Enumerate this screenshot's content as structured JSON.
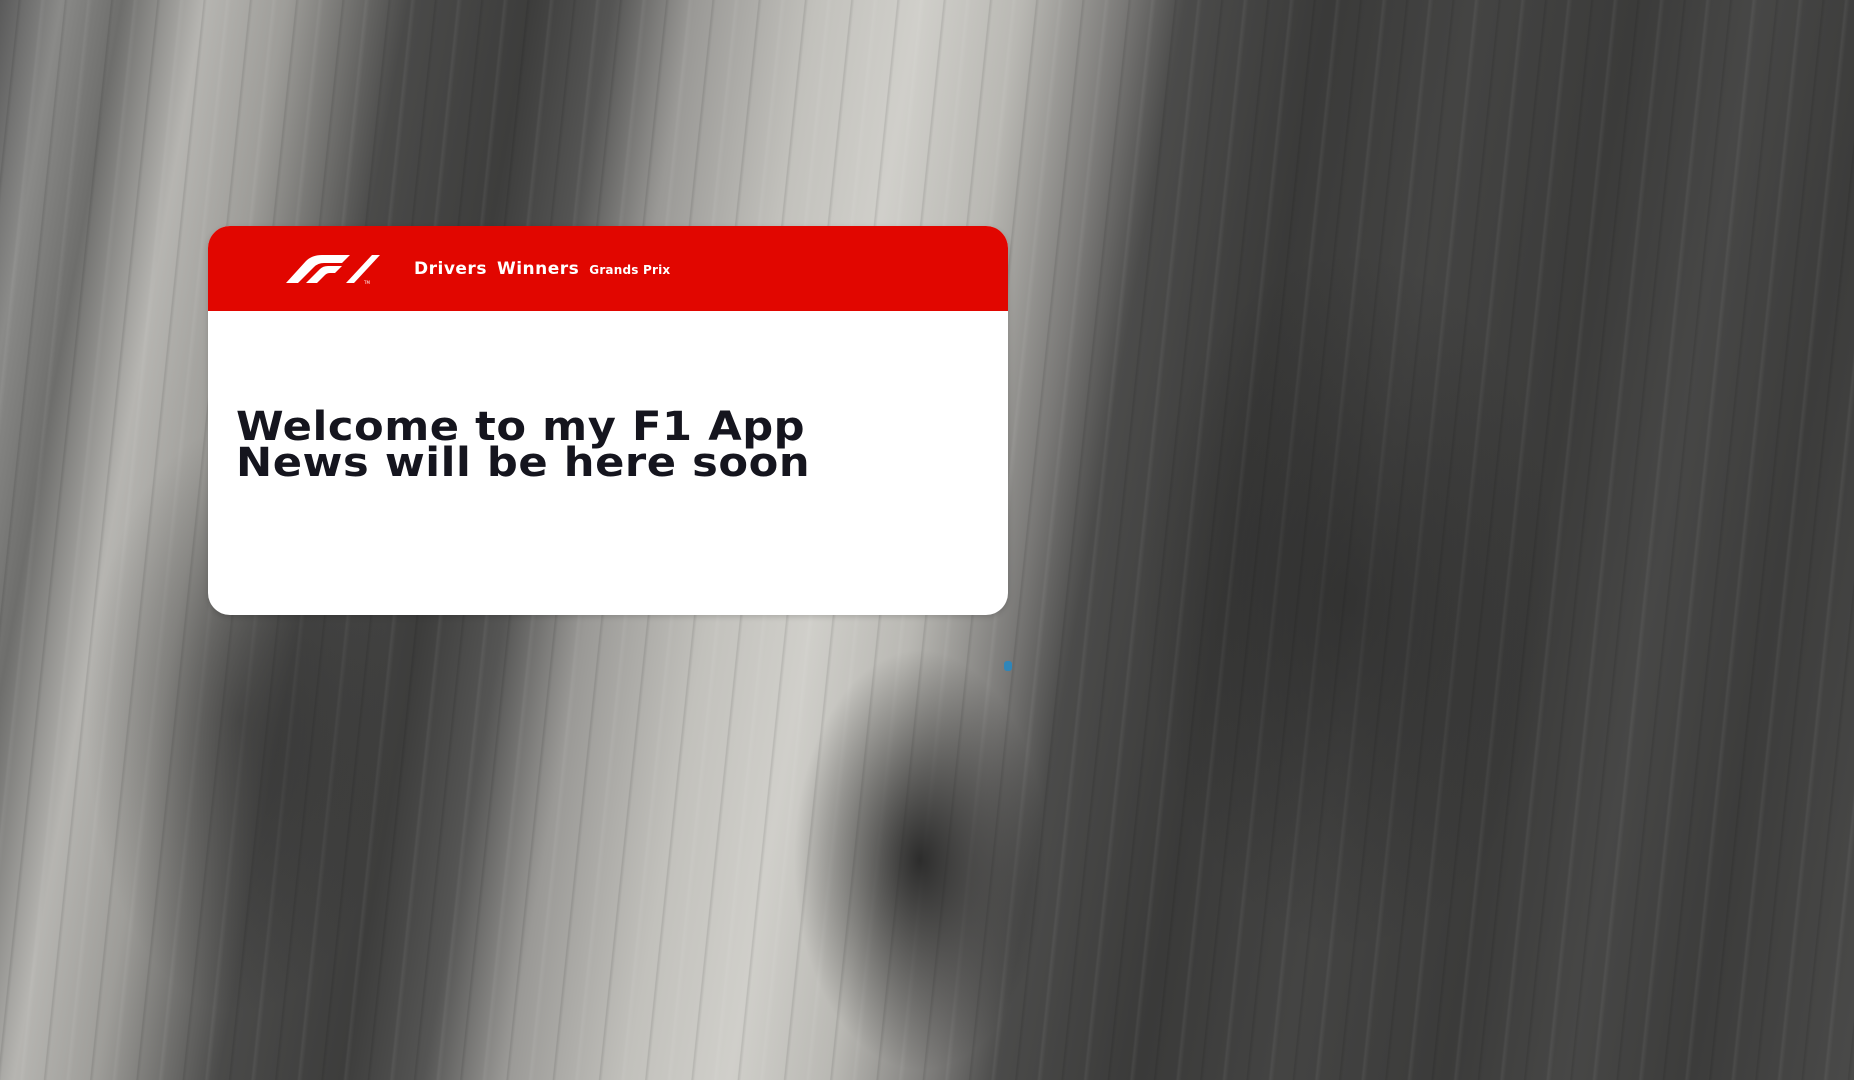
{
  "background": {
    "description_icon": "granite-cliff-photo"
  },
  "header": {
    "logo_icon": "f1-logo-icon",
    "brand_color": "#e10600",
    "nav": {
      "drivers_label": "Drivers",
      "winners_label": "Winners",
      "grands_prix_label": "Grands Prix"
    }
  },
  "main": {
    "headline_line1": "Welcome to my F1 App",
    "headline_line2": "News will be here soon"
  }
}
